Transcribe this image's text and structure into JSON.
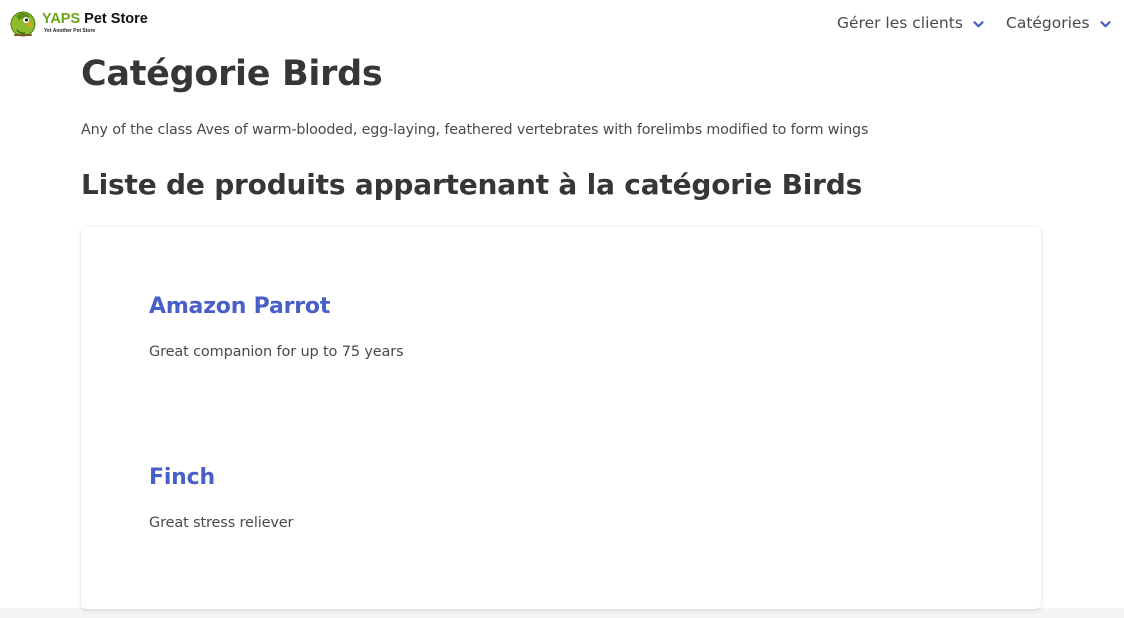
{
  "brand": {
    "title_part1": "YAPS",
    "title_part2": " Pet Store",
    "subtitle": "Yet Another Pet Store"
  },
  "nav": {
    "items": [
      {
        "label": "Gérer les clients",
        "icon": "chevron-down-icon"
      },
      {
        "label": "Catégories",
        "icon": "chevron-down-icon"
      }
    ]
  },
  "category": {
    "title": "Catégorie Birds",
    "description": "Any of the class Aves of warm-blooded, egg-laying, feathered vertebrates with forelimbs modified to form wings",
    "list_title": "Liste de produits appartenant à la catégorie Birds"
  },
  "products": [
    {
      "name": "Amazon Parrot",
      "description": "Great companion for up to 75 years"
    },
    {
      "name": "Finch",
      "description": "Great stress reliever"
    }
  ],
  "colors": {
    "accent": "#485fc7",
    "brand_green": "#6aa51c",
    "text_dark": "#363636",
    "text": "#4a4a4a"
  }
}
